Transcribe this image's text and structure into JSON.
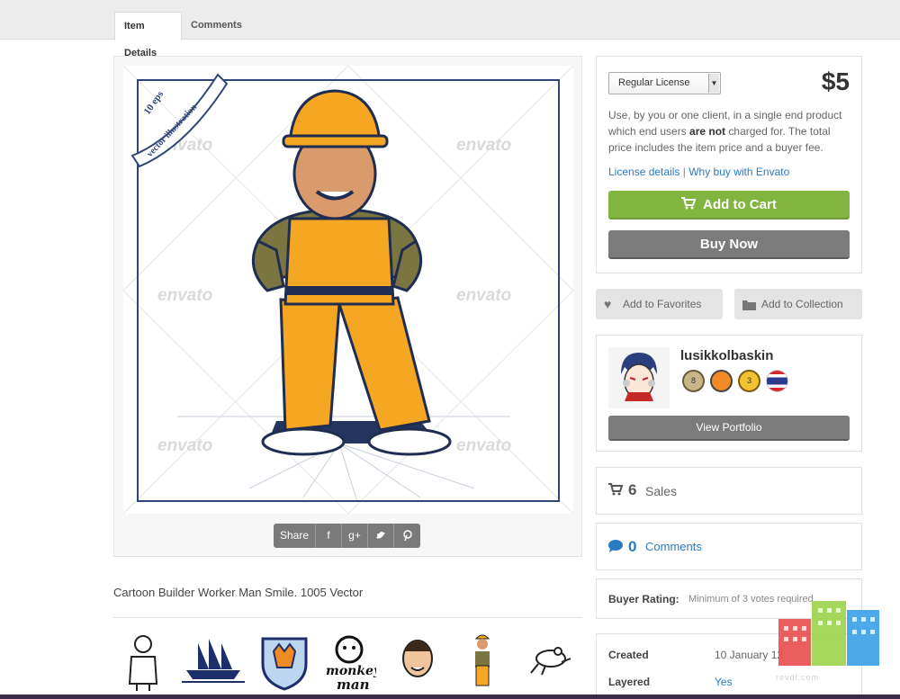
{
  "tabs": {
    "details": "Item Details",
    "comments": "Comments"
  },
  "preview": {
    "watermark": "envato",
    "ribbon_top": "10 eps",
    "ribbon_main": "vector illustration",
    "share_label": "Share",
    "share_icons": [
      "facebook-icon",
      "google-plus-icon",
      "twitter-icon",
      "pinterest-icon"
    ]
  },
  "item": {
    "description": "Cartoon Builder Worker Man Smile. 1005 Vector"
  },
  "thumbs": {
    "monkey_word1": "monkey",
    "monkey_word2": "man"
  },
  "purchase": {
    "license_selected": "Regular License",
    "price": "$5",
    "license_text_1": "Use, by you or one client, in a single end product which end users ",
    "license_text_bold": "are not",
    "license_text_2": " charged for. The total price includes the item price and a buyer fee.",
    "license_details": "License details",
    "link_sep": "|",
    "why_buy": "Why buy with Envato",
    "add_to_cart": "Add to Cart",
    "buy_now": "Buy Now",
    "accent_green": "#82b440"
  },
  "actions": {
    "favorites": "Add to Favorites",
    "collection": "Add to Collection"
  },
  "author": {
    "name": "lusikkolbaskin",
    "view_portfolio": "View Portfolio",
    "badge_level": "8",
    "badge_count": "3"
  },
  "stats": {
    "sales_count": "6",
    "sales_label": "Sales",
    "comments_count": "0",
    "comments_label": "Comments"
  },
  "rating": {
    "label": "Buyer Rating:",
    "value": "Minimum of 3 votes required"
  },
  "meta": {
    "created_label": "Created",
    "created_value": "10 January 12",
    "layered_label": "Layered",
    "layered_value": "Yes"
  },
  "overlay": {
    "site": "revdl.com"
  }
}
